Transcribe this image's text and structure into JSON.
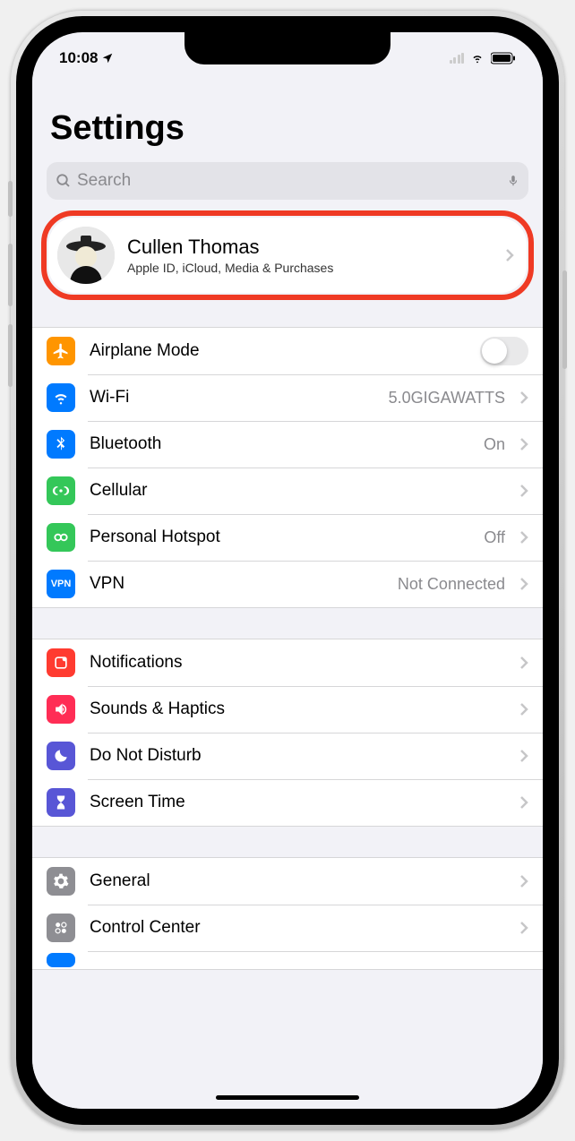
{
  "status": {
    "time": "10:08"
  },
  "title": "Settings",
  "search": {
    "placeholder": "Search"
  },
  "profile": {
    "name": "Cullen Thomas",
    "subtitle": "Apple ID, iCloud, Media & Purchases"
  },
  "group1": {
    "airplane": "Airplane Mode",
    "wifi": "Wi-Fi",
    "wifi_value": "5.0GIGAWATTS",
    "bluetooth": "Bluetooth",
    "bluetooth_value": "On",
    "cellular": "Cellular",
    "hotspot": "Personal Hotspot",
    "hotspot_value": "Off",
    "vpn": "VPN",
    "vpn_value": "Not Connected"
  },
  "group2": {
    "notifications": "Notifications",
    "sounds": "Sounds & Haptics",
    "dnd": "Do Not Disturb",
    "screentime": "Screen Time"
  },
  "group3": {
    "general": "General",
    "control_center": "Control Center"
  }
}
